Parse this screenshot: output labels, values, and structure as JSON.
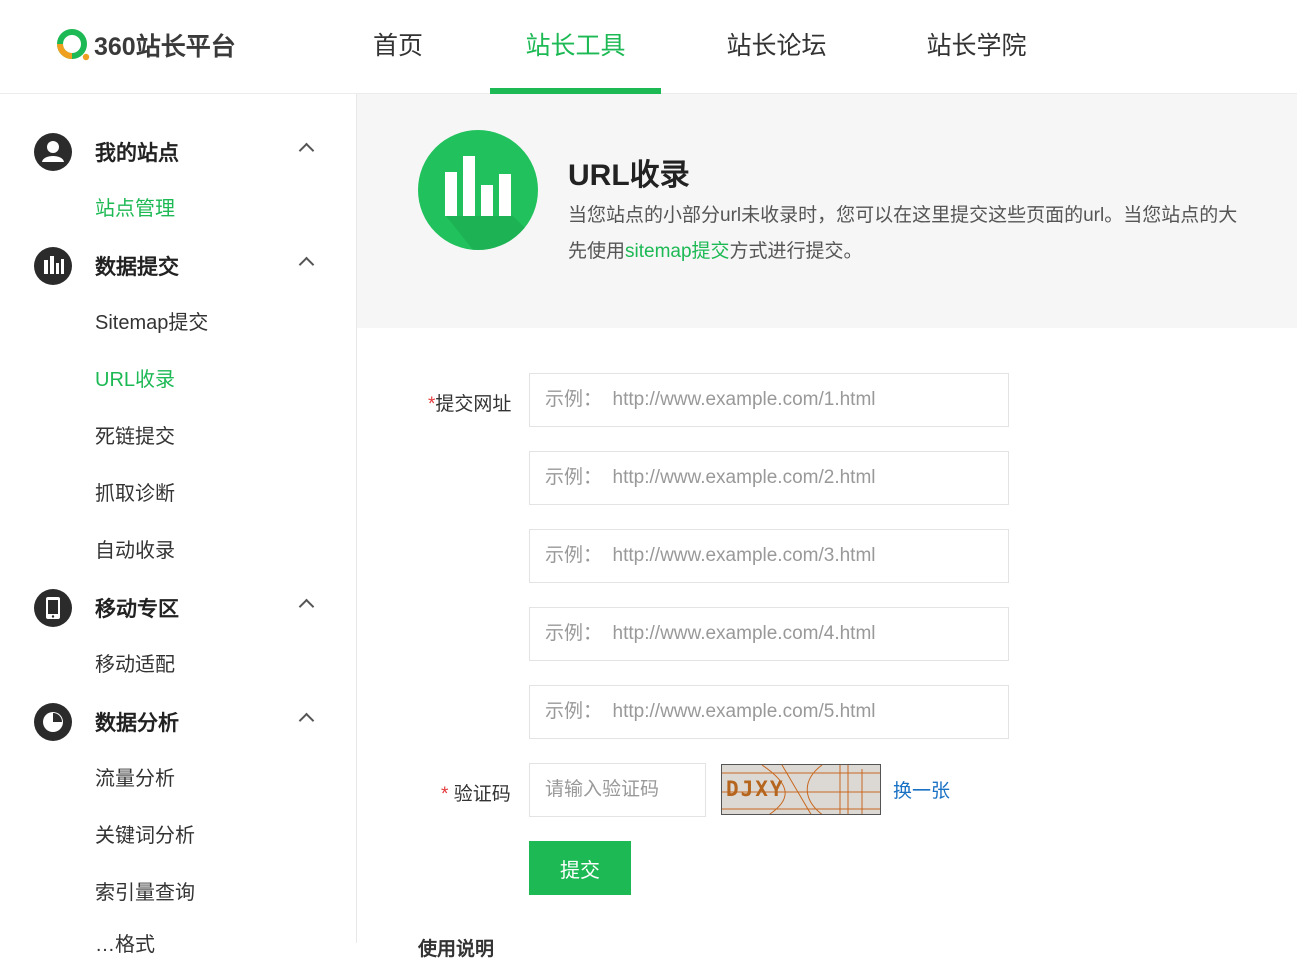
{
  "header": {
    "logo_text": "360站长平台",
    "nav": [
      {
        "label": "首页",
        "active": false
      },
      {
        "label": "站长工具",
        "active": true
      },
      {
        "label": "站长论坛",
        "active": false
      },
      {
        "label": "站长学院",
        "active": false
      }
    ]
  },
  "sidebar": {
    "groups": [
      {
        "title": "我的站点",
        "icon": "user-icon",
        "items": [
          {
            "label": "站点管理",
            "active": true
          }
        ]
      },
      {
        "title": "数据提交",
        "icon": "bar-chart-icon",
        "items": [
          {
            "label": "Sitemap提交",
            "active": false
          },
          {
            "label": "URL收录",
            "active": true
          },
          {
            "label": "死链提交",
            "active": false
          },
          {
            "label": "抓取诊断",
            "active": false
          },
          {
            "label": "自动收录",
            "active": false
          }
        ]
      },
      {
        "title": "移动专区",
        "icon": "mobile-icon",
        "items": [
          {
            "label": "移动适配",
            "active": false
          }
        ]
      },
      {
        "title": "数据分析",
        "icon": "pie-chart-icon",
        "items": [
          {
            "label": "流量分析",
            "active": false
          },
          {
            "label": "关键词分析",
            "active": false
          },
          {
            "label": "索引量查询",
            "active": false
          }
        ]
      }
    ],
    "cut_item": "…格式"
  },
  "banner": {
    "title": "URL收录",
    "desc_line1": "当您站点的小部分url未收录时，您可以在这里提交这些页面的url。当您站点的大",
    "desc_line2_prefix": "先使用",
    "desc_line2_link": "sitemap提交",
    "desc_line2_suffix": "方式进行提交。"
  },
  "form": {
    "url_label_star": "*",
    "url_label": "提交网址",
    "url_placeholders": [
      "示例：  http://www.example.com/1.html",
      "示例：  http://www.example.com/2.html",
      "示例：  http://www.example.com/3.html",
      "示例：  http://www.example.com/4.html",
      "示例：  http://www.example.com/5.html"
    ],
    "captcha_label_star": "*",
    "captcha_label": "验证码",
    "captcha_placeholder": "请输入验证码",
    "captcha_text": "DJXY",
    "captcha_refresh": "换一张",
    "submit": "提交",
    "bottom_heading": "使用说明"
  },
  "colors": {
    "accent": "#1db954",
    "link": "#1a72c4",
    "required": "#e4393c",
    "sidebar_icon_bg": "#2b2b2b"
  }
}
